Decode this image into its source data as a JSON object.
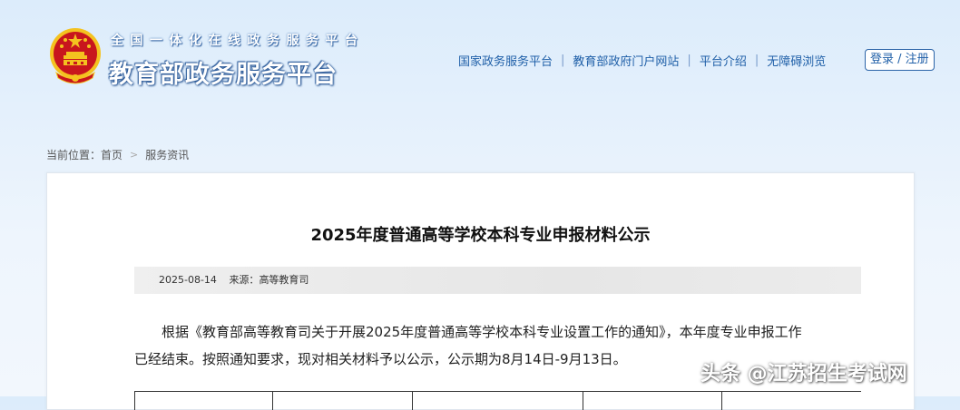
{
  "header": {
    "site_subtitle": "全国一体化在线政务服务平台",
    "site_title": "教育部政务服务平台",
    "nav": [
      {
        "label": "国家政务服务平台"
      },
      {
        "label": "教育部政府门户网站"
      },
      {
        "label": "平台介绍"
      },
      {
        "label": "无障碍浏览"
      }
    ],
    "nav_separator": "|",
    "login_label": "登录 / 注册"
  },
  "breadcrumb": {
    "prefix": "当前位置：",
    "home": "首页",
    "section": "服务资讯",
    "chevron": ">"
  },
  "article": {
    "title": "2025年度普通高等学校本科专业申报材料公示",
    "date": "2025-08-14",
    "source_label": "来源：",
    "source": "高等教育司",
    "para_line1": "根据《教育部高等教育司关于开展2025年度普通高等学校本科专业设置工作的通知》，本年度专业申报工作",
    "para_line2": "已经结束。按照通知要求，现对相关材料予以公示，公示期为8月14日-9月13日。"
  },
  "watermark": {
    "text": "头条 @江苏招生考试网"
  },
  "colors": {
    "link": "#1f5fa8",
    "emblem_red": "#c8161d",
    "emblem_gold": "#f4c21f"
  },
  "icons": {
    "emblem": "national-emblem-icon",
    "breadcrumb_separator": "chevron-right-icon"
  }
}
